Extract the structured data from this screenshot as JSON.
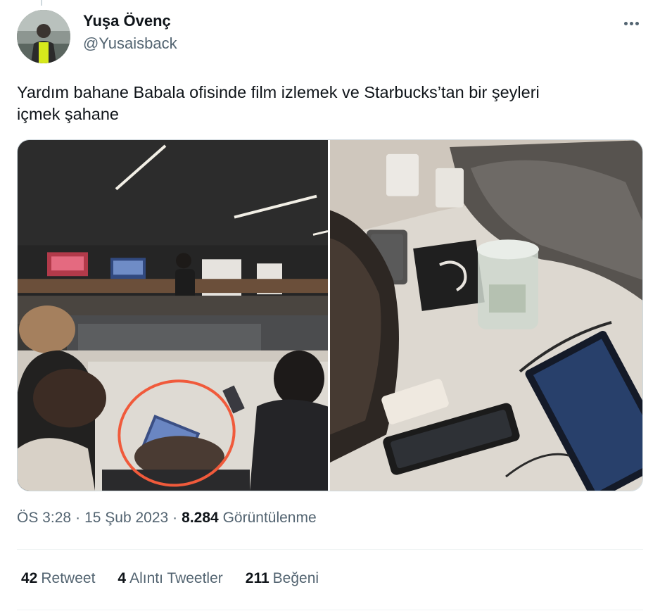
{
  "author": {
    "name": "Yuşa Övenç",
    "handle": "@Yusaisback"
  },
  "menu": {
    "icon": "more-horizontal-icon"
  },
  "tweet": {
    "text_line1": "Yardım bahane Babala ofisinde film izlemek ve Starbucks’tan bir şeyleri",
    "text_line2": "içmek şahane"
  },
  "media": {
    "count": 2,
    "accent_circle_color": "#f05a3b"
  },
  "meta": {
    "time": "ÖS 3:28",
    "separator": "·",
    "date": "15 Şub 2023",
    "views_count": "8.284",
    "views_label": "Görüntülenme"
  },
  "stats": {
    "retweets_count": "42",
    "retweets_label": "Retweet",
    "quotes_count": "4",
    "quotes_label": "Alıntı Tweetler",
    "likes_count": "211",
    "likes_label": "Beğeni"
  },
  "colors": {
    "primary_text": "#0f1419",
    "secondary_text": "#536471",
    "border": "#cfd9de"
  }
}
